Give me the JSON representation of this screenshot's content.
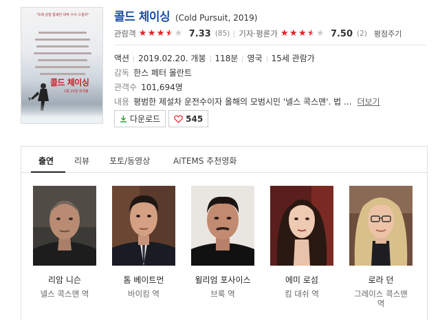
{
  "movie": {
    "title": "콜드 체이싱",
    "title_en": "(Cold Pursuit, 2019)"
  },
  "poster": {
    "tagline": "\"유쾌 살벌 통쾌한 대박 수사 스릴러\"",
    "title": "콜드 체이싱",
    "date": "2월 20일 대개봉"
  },
  "ratings": {
    "audience_label": "관람객",
    "audience_score": "7.33",
    "audience_count": "(85)",
    "audience_stars": [
      1,
      1,
      1,
      0.5,
      0
    ],
    "critic_label": "기자·평론가",
    "critic_score": "7.50",
    "critic_count": "(2)",
    "critic_stars": [
      1,
      1,
      1,
      0.5,
      0
    ],
    "evaluate": "평점주기"
  },
  "info": {
    "genre": "액션",
    "release": "2019.02.20. 개봉",
    "runtime": "118분",
    "country": "영국",
    "age": "15세 관람가",
    "director_label": "감독",
    "director": "한스 페터 몰란트",
    "audience_label": "관객수",
    "audience": "101,694명",
    "plot_label": "내용",
    "plot": "평범한 제설차 운전수이자 올해의 모범시민 '넬스 콕스맨'. 법 ...",
    "more": "더보기"
  },
  "buttons": {
    "download": "다운로드",
    "likes": "545"
  },
  "tabs": [
    {
      "label": "출연"
    },
    {
      "label": "리뷰"
    },
    {
      "label": "포토/동영상"
    },
    {
      "label": "AiTEMS 추천영화"
    }
  ],
  "cast": [
    {
      "name": "리암 니슨",
      "role": "넬스 콕스맨 역"
    },
    {
      "name": "톰 베이트먼",
      "role": "바이킹 역"
    },
    {
      "name": "윌리엄 포사이스",
      "role": "브룩 역"
    },
    {
      "name": "에미 로섬",
      "role": "킴 대쉬 역"
    },
    {
      "name": "로라 던",
      "role": "그레이스 콕스맨 역"
    }
  ],
  "colors": {
    "title": "#1b4ea7",
    "star": "#e52228",
    "poster_accent": "#c62227"
  }
}
